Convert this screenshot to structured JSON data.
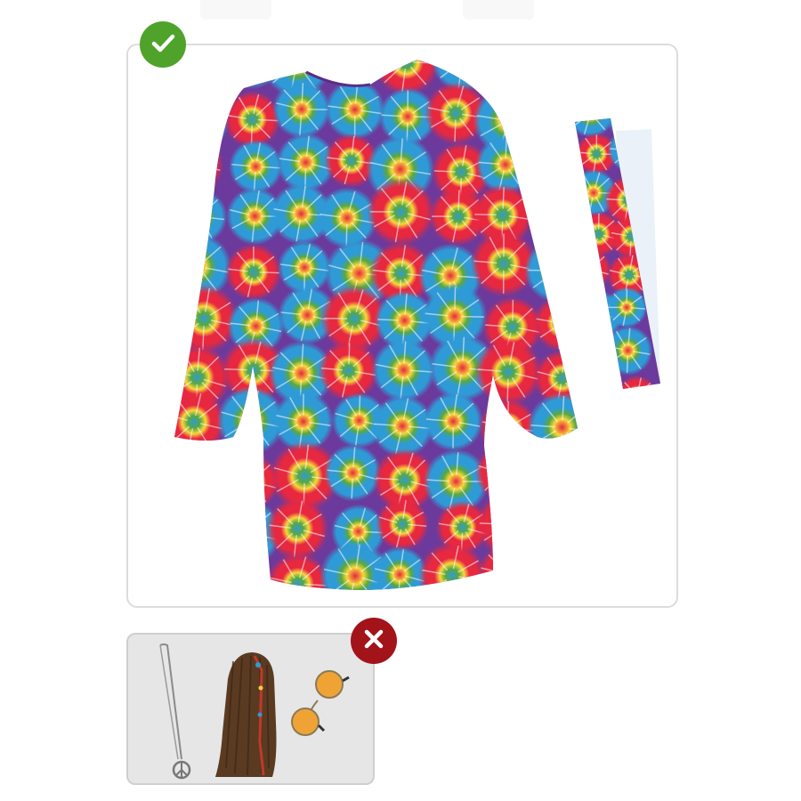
{
  "included": {
    "status_icon": "check-icon",
    "status_color": "#4fa32b",
    "items": [
      {
        "icon": "tie-dye-dress-icon"
      },
      {
        "icon": "tie-dye-headband-icon"
      }
    ]
  },
  "excluded": {
    "status_icon": "close-icon",
    "status_color": "#a3131a",
    "items": [
      {
        "icon": "peace-sign-necklace-icon"
      },
      {
        "icon": "brown-wig-icon"
      },
      {
        "icon": "round-sunglasses-icon"
      }
    ]
  },
  "colors": {
    "tie_dye": [
      "#e8283f",
      "#2f9bd6",
      "#f7d73a",
      "#5aa83e",
      "#6b3a9c",
      "#f08a2c"
    ]
  }
}
